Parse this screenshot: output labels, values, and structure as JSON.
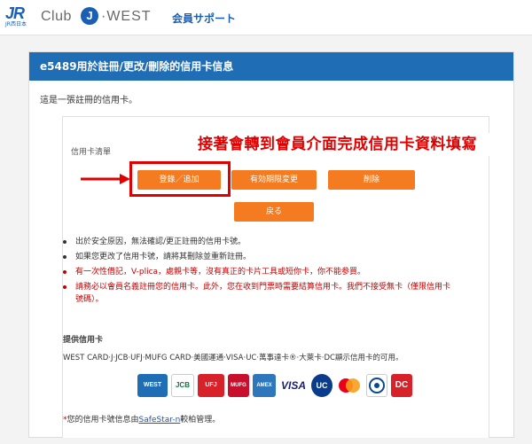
{
  "header": {
    "logo_jr": "JR",
    "logo_jr_sub": "JR西日本",
    "logo_club": "Club",
    "logo_j": "J",
    "logo_west": "·WEST",
    "logo_support": "会員サポート"
  },
  "page_title": "e5489用於註冊/更改/刪除的信用卡信息",
  "intro": "這是一張註冊的信用卡。",
  "card_list_label": "信用卡清單",
  "annotation": "接著會轉到會員介面完成信用卡資料填寫",
  "buttons": {
    "register": "登錄／追加",
    "change_expiry": "有効期限変更",
    "delete": "削除",
    "back": "戻る"
  },
  "notes": [
    "出於安全原因，無法確認/更正註冊的信用卡號。",
    "如果您更改了信用卡號，請將其刪除並重新註冊。",
    "有一次性借記，V-plica，處親卡等，沒有真正的卡片工具或短你卡，你不能参買。",
    "請務必以會員名義註冊您的信用卡。此外，您在收到門票時需要結算信用卡。我們不接受無卡（僅限信用卡號碼）。"
  ],
  "provided_title": "提供信用卡",
  "brands_text": "WEST CARD·J·JCB·UFJ·MUFG CARD·美國運通·VISA·UC·萬事達卡®·大萊卡·DC顯示信用卡的可用。",
  "card_logos": [
    {
      "name": "WEST CARD",
      "label": "WEST"
    },
    {
      "name": "JCB",
      "label": "JCB"
    },
    {
      "name": "UFJ Card",
      "label": "UFJ"
    },
    {
      "name": "MUFG Card",
      "label": "MUFG"
    },
    {
      "name": "American Express",
      "label": "AMEX"
    },
    {
      "name": "VISA",
      "label": "VISA"
    },
    {
      "name": "UC",
      "label": "UC"
    },
    {
      "name": "Mastercard",
      "label": ""
    },
    {
      "name": "Diners Club",
      "label": ""
    },
    {
      "name": "DC",
      "label": "DC"
    }
  ],
  "footnote": {
    "asterisk": "*",
    "prefix": "您的信用卡號信息由",
    "link": "SafeStar-n",
    "suffix": "較柏管理。"
  },
  "colors": {
    "brand_blue": "#1f6db4",
    "button_orange": "#f47b20",
    "annotation_red": "#e00000"
  }
}
